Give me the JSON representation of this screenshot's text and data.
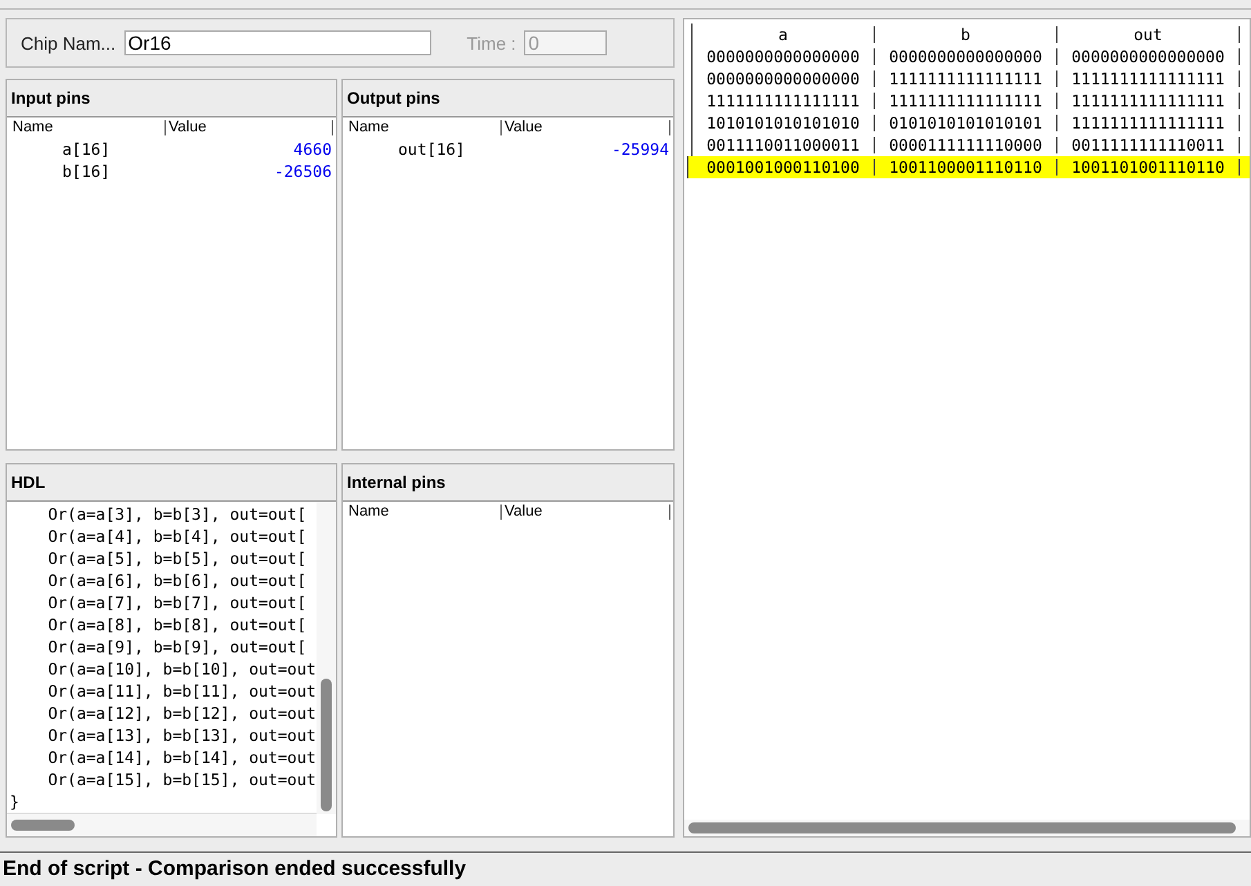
{
  "chip_name": {
    "label": "Chip Nam...",
    "value": "Or16"
  },
  "time": {
    "label": "Time :",
    "value": "0",
    "disabled": true
  },
  "input_pins": {
    "title": "Input pins",
    "columns": [
      "Name",
      "Value"
    ],
    "rows": [
      {
        "name": "a[16]",
        "value": "4660"
      },
      {
        "name": "b[16]",
        "value": "-26506"
      }
    ]
  },
  "output_pins": {
    "title": "Output pins",
    "columns": [
      "Name",
      "Value"
    ],
    "rows": [
      {
        "name": "out[16]",
        "value": "-25994"
      }
    ]
  },
  "hdl": {
    "title": "HDL",
    "lines": [
      "    Or(a=a[3], b=b[3], out=out[",
      "    Or(a=a[4], b=b[4], out=out[",
      "    Or(a=a[5], b=b[5], out=out[",
      "    Or(a=a[6], b=b[6], out=out[",
      "    Or(a=a[7], b=b[7], out=out[",
      "    Or(a=a[8], b=b[8], out=out[",
      "    Or(a=a[9], b=b[9], out=out[",
      "    Or(a=a[10], b=b[10], out=out",
      "    Or(a=a[11], b=b[11], out=out",
      "    Or(a=a[12], b=b[12], out=out",
      "    Or(a=a[13], b=b[13], out=out",
      "    Or(a=a[14], b=b[14], out=out",
      "    Or(a=a[15], b=b[15], out=out",
      "}"
    ]
  },
  "internal_pins": {
    "title": "Internal pins",
    "columns": [
      "Name",
      "Value"
    ]
  },
  "compare": {
    "columns": [
      "a",
      "b",
      "out"
    ],
    "rows": [
      {
        "cells": [
          "0000000000000000",
          "0000000000000000",
          "0000000000000000"
        ],
        "selected": false
      },
      {
        "cells": [
          "0000000000000000",
          "1111111111111111",
          "1111111111111111"
        ],
        "selected": false
      },
      {
        "cells": [
          "1111111111111111",
          "1111111111111111",
          "1111111111111111"
        ],
        "selected": false
      },
      {
        "cells": [
          "1010101010101010",
          "0101010101010101",
          "1111111111111111"
        ],
        "selected": false
      },
      {
        "cells": [
          "0011110011000011",
          "0000111111110000",
          "0011111111110011"
        ],
        "selected": false
      },
      {
        "cells": [
          "0001001000110100",
          "1001100001110110",
          "1001101001110110"
        ],
        "selected": true
      }
    ]
  },
  "status_bar": "End of script - Comparison ended successfully"
}
